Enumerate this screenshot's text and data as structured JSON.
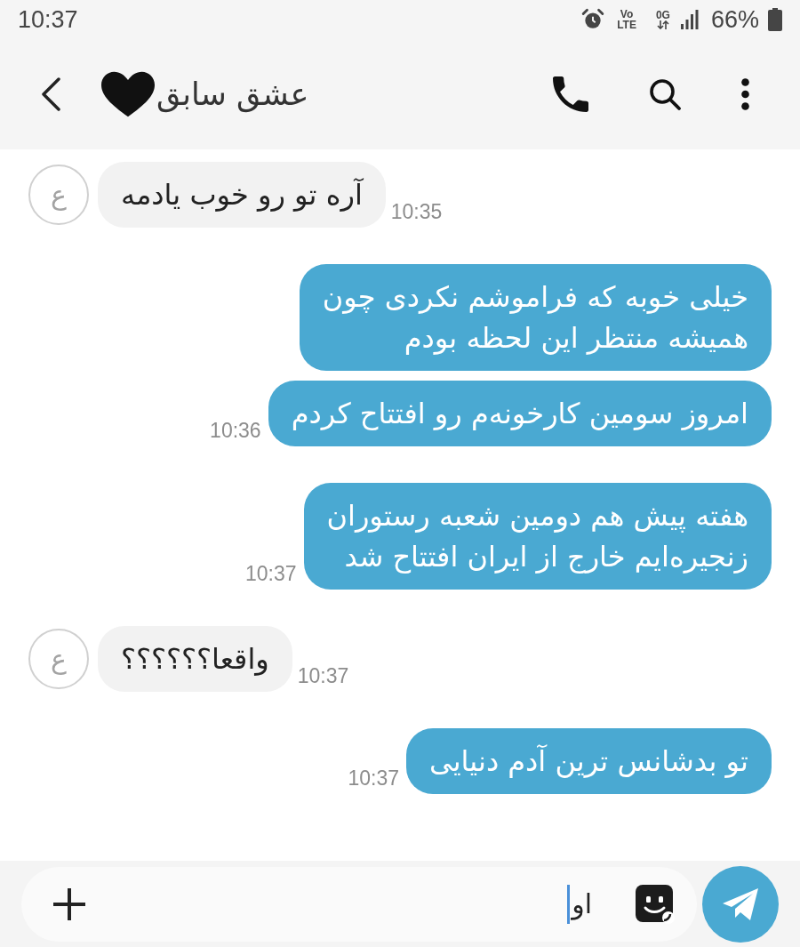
{
  "status_bar": {
    "time": "10:37",
    "volte_top": "Vo",
    "volte_bottom": "LTE",
    "data_label": "0G",
    "battery": "66%"
  },
  "header": {
    "title": "عشق سابق"
  },
  "messages": [
    {
      "kind": "received",
      "avatar_letter": "ع",
      "text": "آره تو رو خوب یادمه",
      "time": "10:35"
    },
    {
      "kind": "sent",
      "text": "خیلی خوبه که فراموشم نکردی چون\nهمیشه منتظر این لحظه بودم"
    },
    {
      "kind": "sent",
      "text": "امروز سومین کارخونه‌م رو افتتاح کردم",
      "time": "10:36"
    },
    {
      "kind": "sent",
      "text": "هفته پیش هم دومین شعبه رستوران\nزنجیره‌ایم خارج از ایران افتتاح شد",
      "time": "10:37"
    },
    {
      "kind": "received",
      "avatar_letter": "ع",
      "text": "واقعا؟؟؟؟؟؟",
      "time": "10:37"
    },
    {
      "kind": "sent",
      "text": "تو بدشانس ترین آدم دنیایی",
      "time": "10:37"
    }
  ],
  "composer": {
    "value": "او"
  }
}
